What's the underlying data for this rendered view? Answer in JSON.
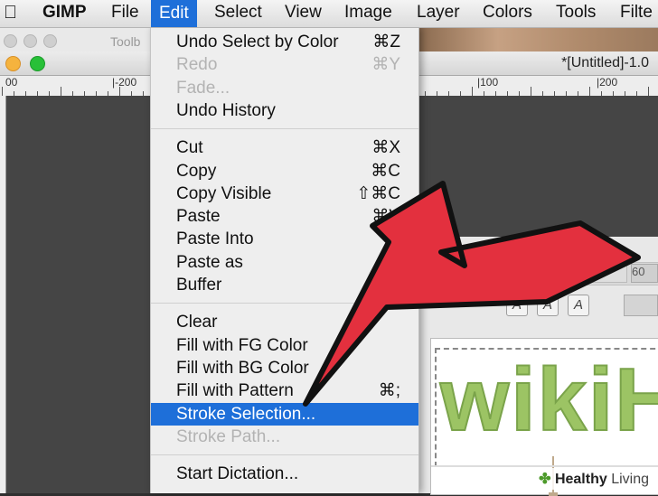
{
  "menubar": {
    "apple_glyph": "",
    "app_name": "GIMP",
    "items": [
      "File",
      "Edit",
      "Select",
      "View",
      "Image",
      "Layer",
      "Colors",
      "Tools",
      "Filte"
    ]
  },
  "toolbox": {
    "title": "Toolb"
  },
  "image_window": {
    "title": "*[Untitled]-1.0",
    "ruler_labels": [
      "00",
      "|-200",
      "|100",
      "|200"
    ]
  },
  "edit_menu": {
    "groups": [
      [
        {
          "label": "Undo Select by Color",
          "shortcut": "⌘Z",
          "enabled": true
        },
        {
          "label": "Redo",
          "shortcut": "⌘Y",
          "enabled": false
        },
        {
          "label": "Fade...",
          "shortcut": "",
          "enabled": false
        },
        {
          "label": "Undo History",
          "shortcut": "",
          "enabled": true
        }
      ],
      [
        {
          "label": "Cut",
          "shortcut": "⌘X",
          "enabled": true
        },
        {
          "label": "Copy",
          "shortcut": "⌘C",
          "enabled": true
        },
        {
          "label": "Copy Visible",
          "shortcut": "⇧⌘C",
          "enabled": true
        },
        {
          "label": "Paste",
          "shortcut": "⌘V",
          "enabled": true
        },
        {
          "label": "Paste Into",
          "shortcut": "",
          "enabled": true
        },
        {
          "label": "Paste as",
          "shortcut": "",
          "enabled": true
        },
        {
          "label": "Buffer",
          "shortcut": "",
          "enabled": true
        }
      ],
      [
        {
          "label": "Clear",
          "shortcut": "",
          "enabled": true
        },
        {
          "label": "Fill with FG Color",
          "shortcut": "",
          "enabled": true
        },
        {
          "label": "Fill with BG Color",
          "shortcut": "",
          "enabled": true
        },
        {
          "label": "Fill with Pattern",
          "shortcut": "⌘;",
          "enabled": true
        },
        {
          "label": "Stroke Selection...",
          "shortcut": "",
          "enabled": true,
          "highlighted": true
        },
        {
          "label": "Stroke Path...",
          "shortcut": "",
          "enabled": false
        }
      ],
      [
        {
          "label": "Start Dictation...",
          "shortcut": "",
          "enabled": true
        }
      ]
    ]
  },
  "dialog": {
    "size_value": "60",
    "style_buttons": [
      "A",
      "A",
      "A"
    ],
    "canvas_text": "wikiH"
  },
  "watermark": {
    "brand": "Healthy",
    "suffix": " Living"
  },
  "colors": {
    "highlight": "#1e6fd9",
    "arrow": "#e3303e",
    "canvas_text": "#9cc464"
  }
}
